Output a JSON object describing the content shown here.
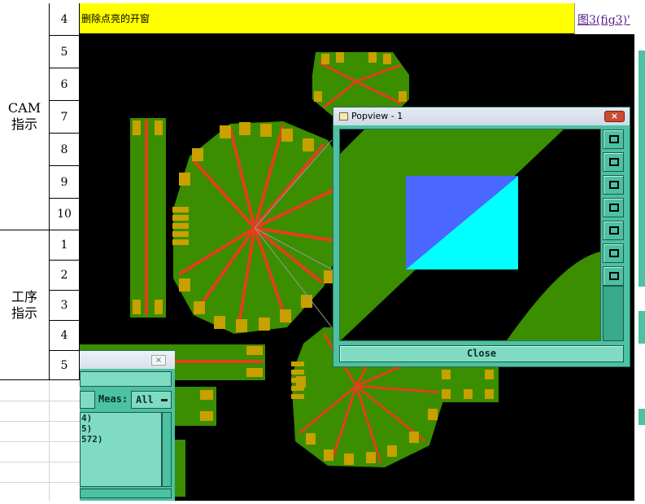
{
  "sheet": {
    "groups": [
      {
        "label_line1": "CAM",
        "label_line2": "指示"
      },
      {
        "label_line1": "工序",
        "label_line2": "指示"
      }
    ],
    "cam_rows": [
      "4",
      "5",
      "6",
      "7",
      "8",
      "9",
      "10"
    ],
    "proc_rows": [
      "1",
      "2",
      "3",
      "4",
      "5"
    ],
    "header_description": "删除点亮的开窗",
    "header_link": "图3(fig3)'"
  },
  "popview": {
    "title": "Popview - 1",
    "close_x": "×",
    "close_button": "Close",
    "tool_icons": [
      "zoom-fit-icon",
      "pan-up-icon",
      "pan-down-icon",
      "pan-left-icon",
      "pan-right-icon",
      "zoom-in-icon",
      "zoom-out-icon"
    ]
  },
  "measure_window": {
    "close_x": "×",
    "meas_label": "Meas:",
    "meas_value": "All",
    "list_items": [
      "4)",
      "5)",
      "572)"
    ]
  },
  "colors": {
    "highlight_yellow": "#ffff00",
    "copper_green": "#3a8e00",
    "pad_gold": "#c8a000",
    "trace_red": "#e0401a",
    "selection_blue": "#4a68ff",
    "selection_cyan": "#00ffff",
    "panel_teal": "#4cc1a4"
  }
}
